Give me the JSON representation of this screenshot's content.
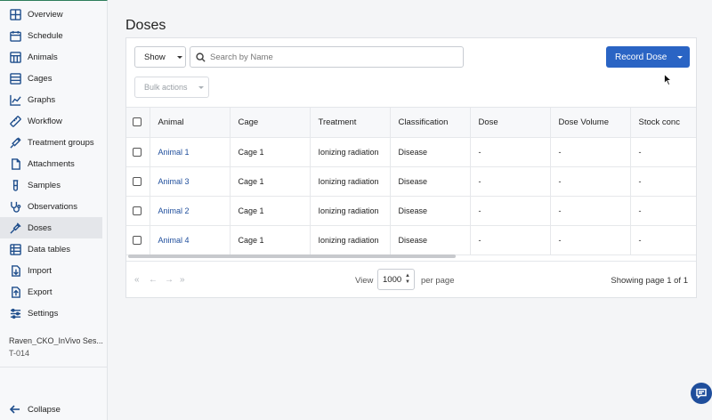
{
  "sidebar": {
    "items": [
      {
        "label": "Overview",
        "icon": "overview-icon"
      },
      {
        "label": "Schedule",
        "icon": "calendar-icon"
      },
      {
        "label": "Animals",
        "icon": "animals-icon"
      },
      {
        "label": "Cages",
        "icon": "cages-icon"
      },
      {
        "label": "Graphs",
        "icon": "chart-icon"
      },
      {
        "label": "Workflow",
        "icon": "ruler-icon"
      },
      {
        "label": "Treatment groups",
        "icon": "syringe-icon"
      },
      {
        "label": "Attachments",
        "icon": "file-icon"
      },
      {
        "label": "Samples",
        "icon": "test-tube-icon"
      },
      {
        "label": "Observations",
        "icon": "stethoscope-icon"
      },
      {
        "label": "Doses",
        "icon": "pipette-icon",
        "active": true
      },
      {
        "label": "Data tables",
        "icon": "table-icon"
      },
      {
        "label": "Import",
        "icon": "import-icon"
      },
      {
        "label": "Export",
        "icon": "export-icon"
      },
      {
        "label": "Settings",
        "icon": "sliders-icon"
      }
    ],
    "study_name": "Raven_CKO_InVivo Ses...",
    "study_code": "T-014",
    "collapse_label": "Collapse"
  },
  "page": {
    "title": "Doses"
  },
  "toolbar": {
    "show_label": "Show",
    "search_placeholder": "Search by Name",
    "record_label": "Record Dose",
    "bulk_label": "Bulk actions"
  },
  "table": {
    "columns": [
      "Animal",
      "Cage",
      "Treatment",
      "Classification",
      "Dose",
      "Dose Volume",
      "Stock conc"
    ],
    "rows": [
      [
        "Animal 1",
        "Cage 1",
        "Ionizing radiation",
        "Disease",
        "-",
        "-",
        "-"
      ],
      [
        "Animal 3",
        "Cage 1",
        "Ionizing radiation",
        "Disease",
        "-",
        "-",
        "-"
      ],
      [
        "Animal 2",
        "Cage 1",
        "Ionizing radiation",
        "Disease",
        "-",
        "-",
        "-"
      ],
      [
        "Animal 4",
        "Cage 1",
        "Ionizing radiation",
        "Disease",
        "-",
        "-",
        "-"
      ]
    ]
  },
  "pagination": {
    "first": "«",
    "prev": "←",
    "next": "→",
    "last": "»",
    "view_label": "View",
    "page_size": "1000",
    "per_page_label": "per page",
    "showing": "Showing page 1 of 1"
  },
  "colors": {
    "primary": "#2a64c4",
    "link": "#1f4e9c",
    "icon": "#1f4e8c"
  }
}
